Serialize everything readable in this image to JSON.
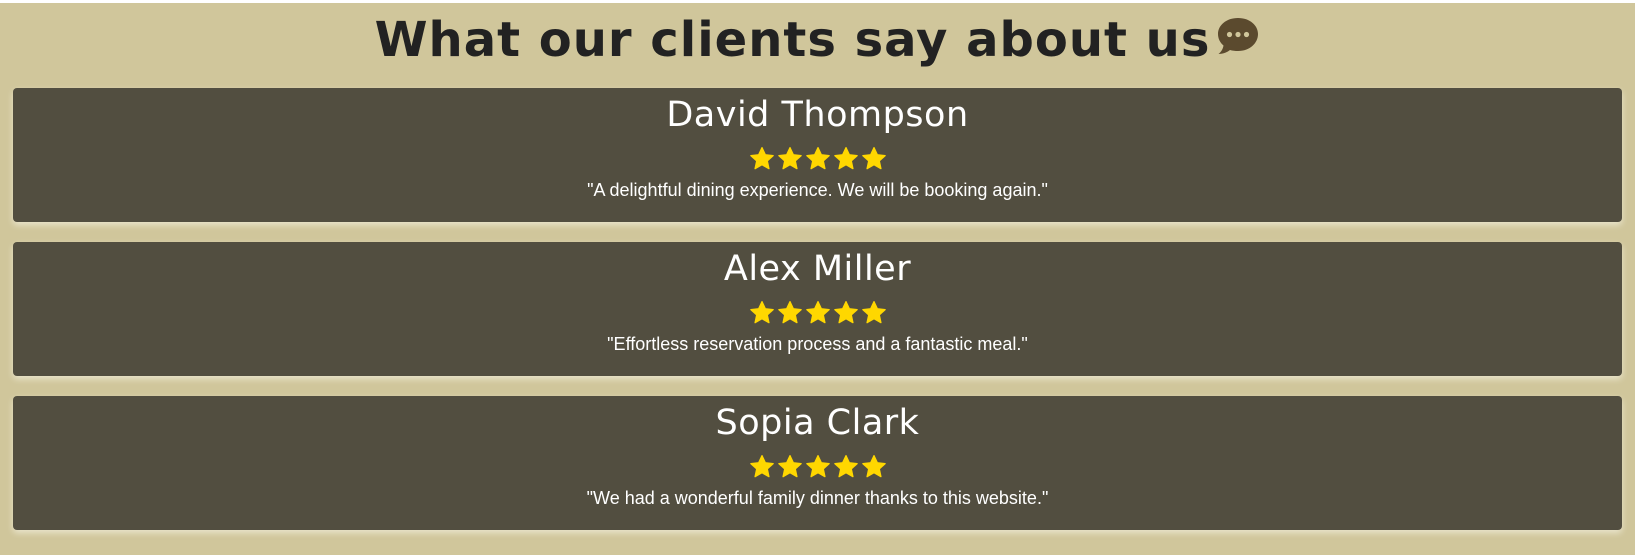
{
  "testimonials_section": {
    "heading": "What our clients say about us",
    "heading_icon": "comment-dots-icon",
    "background_color": "#d0c69b",
    "card_color": "#524e40",
    "star_color": "#ffd700",
    "star_icon": "star-icon",
    "reviews": [
      {
        "name": "David Thompson",
        "rating": 5,
        "quote": "\"A delightful dining experience. We will be booking again.\""
      },
      {
        "name": "Alex Miller",
        "rating": 5,
        "quote": "\"Effortless reservation process and a fantastic meal.\""
      },
      {
        "name": "Sopia Clark",
        "rating": 5,
        "quote": "\"We had a wonderful family dinner thanks to this website.\""
      }
    ]
  }
}
